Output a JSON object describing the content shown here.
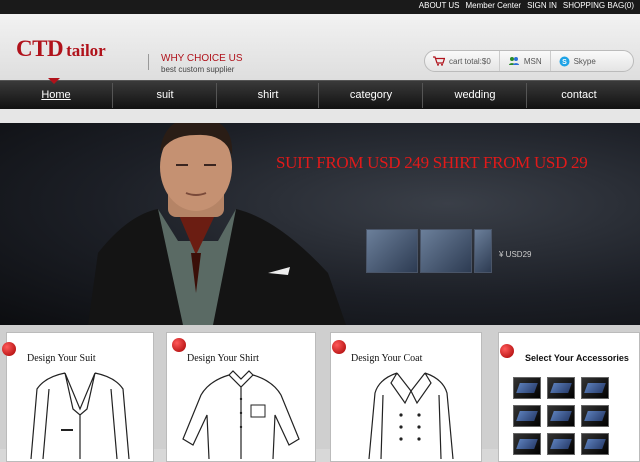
{
  "topbar": {
    "links": [
      "ABOUT US",
      "Member Center",
      "SIGN IN",
      "SHOPPING BAG(0)"
    ]
  },
  "header": {
    "logo_main": "CTD",
    "logo_sub": "tailor",
    "why_title": "WHY CHOICE US",
    "why_sub": "best custom supplier",
    "cart_label": "cart total:$0",
    "msn_label": "MSN",
    "skype_label": "Skype"
  },
  "nav": {
    "items": [
      "Home",
      "suit",
      "shirt",
      "category",
      "wedding",
      "contact"
    ],
    "active": "Home"
  },
  "banner": {
    "promo": "SUIT FROM USD 249  SHIRT FROM USD 29",
    "price_tag": "¥ USD29"
  },
  "cards": {
    "suit_title": "Design  Your Suit",
    "shirt_title": "Design  Your Shirt",
    "coat_title": "Design  Your Coat",
    "accessories_title": "Select Your Accessories"
  },
  "colors": {
    "brand_red": "#b0121b",
    "promo_red": "#e01a1a",
    "nav_dark": "#1a1a1a"
  }
}
